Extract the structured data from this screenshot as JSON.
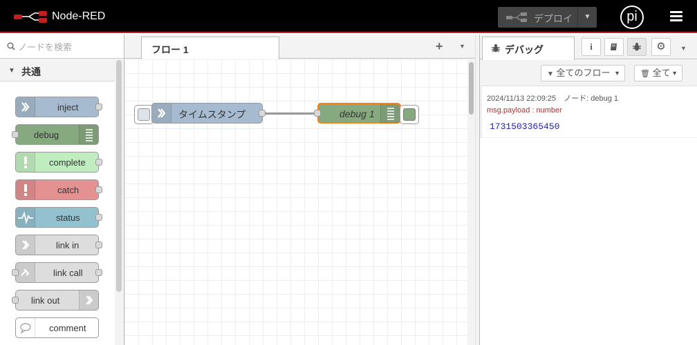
{
  "header": {
    "title": "Node-RED",
    "deploy_label": "デプロイ",
    "avatar_text": "pi",
    "colors": {
      "background": "#000000",
      "accent": "#c02020",
      "deploy": "#444444"
    },
    "icons": {
      "logo": "node-red-logo-icon",
      "deploy": "deploy-icon",
      "menu": "hamburger-menu-icon"
    }
  },
  "palette": {
    "search_placeholder": "ノードを検索",
    "category": "共通",
    "nodes": [
      {
        "label": "inject",
        "color": "#a6bbcf"
      },
      {
        "label": "debug",
        "color": "#87a980"
      },
      {
        "label": "complete",
        "color": "#c0edc0"
      },
      {
        "label": "catch",
        "color": "#e49191"
      },
      {
        "label": "status",
        "color": "#94c1d0"
      },
      {
        "label": "link in",
        "color": "#dddddd"
      },
      {
        "label": "link call",
        "color": "#dddddd"
      },
      {
        "label": "link out",
        "color": "#dddddd"
      },
      {
        "label": "comment",
        "color": "#ffffff"
      }
    ]
  },
  "workspace": {
    "tab_label": "フロー 1",
    "nodes": [
      {
        "label": "タイムスタンプ",
        "color": "#a6bbcf"
      },
      {
        "label": "debug 1",
        "color": "#87a980"
      }
    ]
  },
  "sidebar": {
    "tab_label": "デバッグ",
    "filter_label": "全てのフロー",
    "clear_label": "全て",
    "message": {
      "meta": "2024/11/13 22:09:25　ノード: debug 1",
      "name": "msg.payload : number",
      "value": "1731503365450"
    }
  }
}
